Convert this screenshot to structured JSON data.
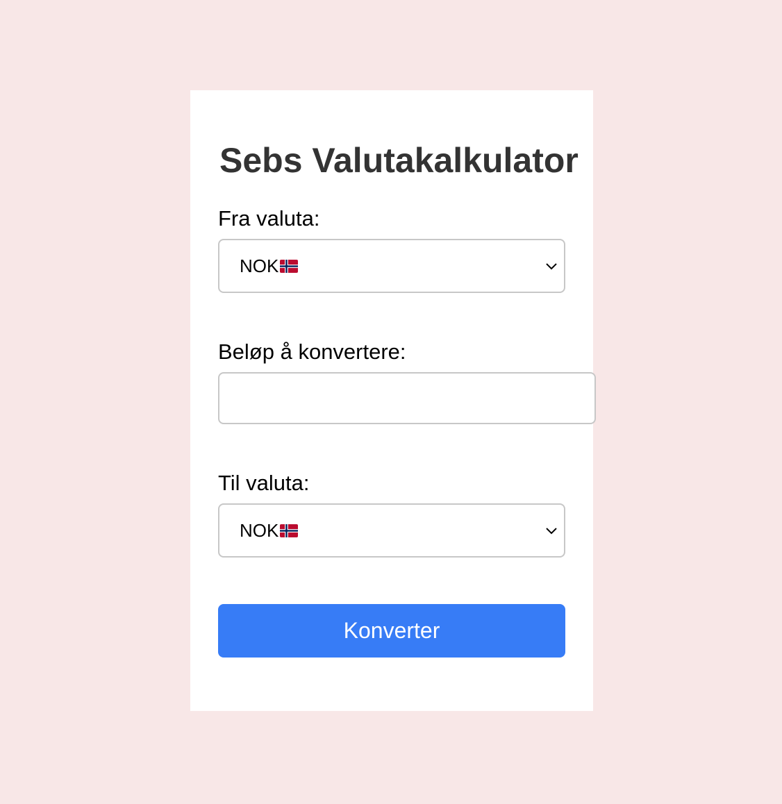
{
  "title": "Sebs Valutakalkulator",
  "from": {
    "label": "Fra valuta:",
    "selected": "NOK",
    "flag_icon": "norway-flag-icon"
  },
  "amount": {
    "label": "Beløp å konvertere:",
    "value": "",
    "placeholder": ""
  },
  "to": {
    "label": "Til valuta:",
    "selected": "NOK",
    "flag_icon": "norway-flag-icon"
  },
  "button": {
    "label": "Konverter"
  },
  "colors": {
    "background": "#f8e7e7",
    "card": "#ffffff",
    "accent": "#377cf6",
    "title": "#333333",
    "border": "#c7c7c7"
  }
}
